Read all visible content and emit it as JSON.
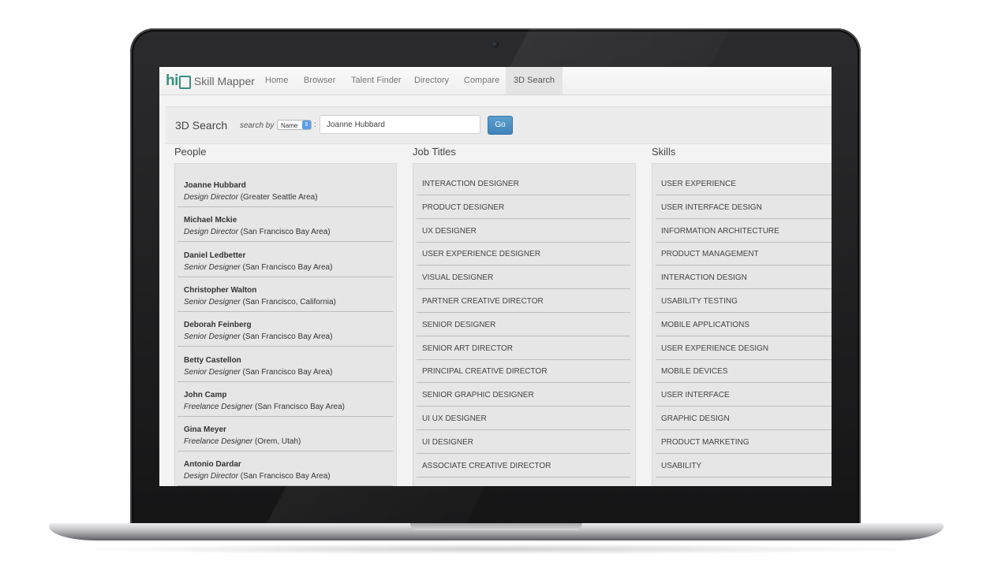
{
  "app": {
    "brand_hi": "hi",
    "brand_name": "Skill Mapper"
  },
  "nav": {
    "items": [
      {
        "label": "Home"
      },
      {
        "label": "Browser"
      },
      {
        "label": "Talent Finder"
      },
      {
        "label": "Directory"
      },
      {
        "label": "Compare"
      },
      {
        "label": "3D Search",
        "active": true
      }
    ]
  },
  "search": {
    "title": "3D Search",
    "by_label": "search by",
    "select_value": "Name",
    "colon": ":",
    "input_value": "Joanne Hubbard",
    "go_label": "Go"
  },
  "people": {
    "title": "People",
    "items": [
      {
        "name": "Joanne Hubbard",
        "title": "Design Director",
        "location": " (Greater Seattle Area)"
      },
      {
        "name": "Michael Mckie",
        "title": "Design Director",
        "location": " (San Francisco Bay Area)"
      },
      {
        "name": "Daniel Ledbetter",
        "title": "Senior Designer",
        "location": " (San Francisco Bay Area)"
      },
      {
        "name": "Christopher Walton",
        "title": "Senior Designer",
        "location": " (San Francisco, California)"
      },
      {
        "name": "Deborah Feinberg",
        "title": "Senior Designer",
        "location": " (San Francisco Bay Area)"
      },
      {
        "name": "Betty Castellon",
        "title": "Senior Designer",
        "location": " (San Francisco Bay Area)"
      },
      {
        "name": "John Camp",
        "title": "Freelance Designer",
        "location": " (San Francisco Bay Area)"
      },
      {
        "name": "Gina Meyer",
        "title": "Freelance Designer",
        "location": " (Orem, Utah)"
      },
      {
        "name": "Antonio Dardar",
        "title": "Design Director",
        "location": " (San Francisco Bay Area)"
      }
    ]
  },
  "job_titles": {
    "title": "Job Titles",
    "items": [
      "INTERACTION DESIGNER",
      "PRODUCT DESIGNER",
      "UX DESIGNER",
      "USER EXPERIENCE DESIGNER",
      "VISUAL DESIGNER",
      "PARTNER CREATIVE DIRECTOR",
      "SENIOR DESIGNER",
      "SENIOR ART DIRECTOR",
      "PRINCIPAL CREATIVE DIRECTOR",
      "SENIOR GRAPHIC DESIGNER",
      "UI UX DESIGNER",
      "UI DESIGNER",
      "ASSOCIATE CREATIVE DIRECTOR"
    ]
  },
  "skills": {
    "title": "Skills",
    "items": [
      "USER EXPERIENCE",
      "USER INTERFACE DESIGN",
      "INFORMATION ARCHITECTURE",
      "PRODUCT MANAGEMENT",
      "INTERACTION DESIGN",
      "USABILITY TESTING",
      "MOBILE APPLICATIONS",
      "USER EXPERIENCE DESIGN",
      "MOBILE DEVICES",
      "USER INTERFACE",
      "GRAPHIC DESIGN",
      "PRODUCT MARKETING",
      "USABILITY"
    ]
  },
  "colors": {
    "brand": "#3b8f7e",
    "go_button": "#4a8fc6",
    "select_arrow": "#5b9ee8"
  }
}
